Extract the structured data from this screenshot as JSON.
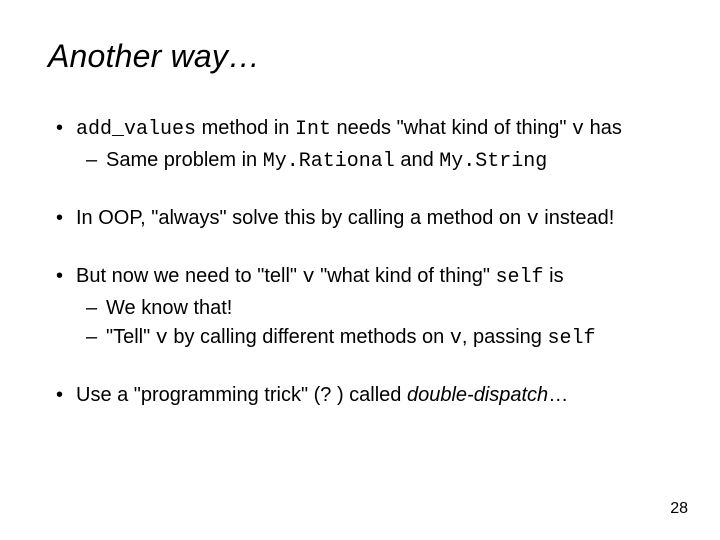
{
  "title": "Another way…",
  "b1": {
    "t1": "add_values",
    "t2": " method in ",
    "t3": "Int",
    "t4": " needs \"what kind of thing\" ",
    "t5": "v",
    "t6": " has",
    "s1a": "Same problem in ",
    "s1b": "My.Rational",
    "s1c": " and ",
    "s1d": "My.String"
  },
  "b2": {
    "t1": "In OOP, \"always\" solve this by calling a method on ",
    "t2": "v",
    "t3": " instead!"
  },
  "b3": {
    "t1": "But now we need to \"tell\" ",
    "t2": "v",
    "t3": " \"what kind of thing\" ",
    "t4": "self",
    "t5": " is",
    "s1": "We know that!",
    "s2a": "\"Tell\" ",
    "s2b": "v",
    "s2c": " by calling different methods on ",
    "s2d": "v",
    "s2e": ", passing ",
    "s2f": "self"
  },
  "b4": {
    "t1": "Use a \"programming trick\" (? ) called ",
    "t2": "double-dispatch",
    "t3": "…"
  },
  "page": "28"
}
